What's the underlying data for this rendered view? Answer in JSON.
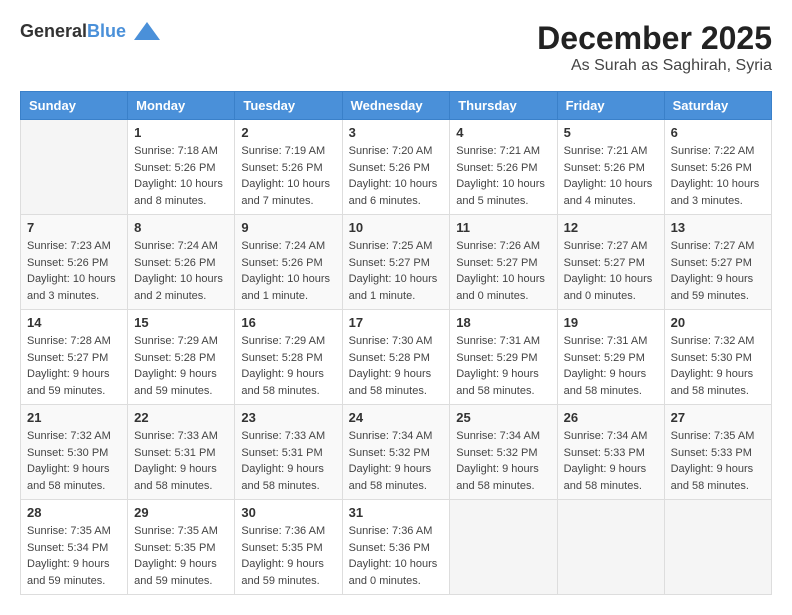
{
  "logo": {
    "general": "General",
    "blue": "Blue"
  },
  "header": {
    "month": "December 2025",
    "location": "As Surah as Saghirah, Syria"
  },
  "weekdays": [
    "Sunday",
    "Monday",
    "Tuesday",
    "Wednesday",
    "Thursday",
    "Friday",
    "Saturday"
  ],
  "weeks": [
    [
      {
        "day": "",
        "info": ""
      },
      {
        "day": "1",
        "info": "Sunrise: 7:18 AM\nSunset: 5:26 PM\nDaylight: 10 hours\nand 8 minutes."
      },
      {
        "day": "2",
        "info": "Sunrise: 7:19 AM\nSunset: 5:26 PM\nDaylight: 10 hours\nand 7 minutes."
      },
      {
        "day": "3",
        "info": "Sunrise: 7:20 AM\nSunset: 5:26 PM\nDaylight: 10 hours\nand 6 minutes."
      },
      {
        "day": "4",
        "info": "Sunrise: 7:21 AM\nSunset: 5:26 PM\nDaylight: 10 hours\nand 5 minutes."
      },
      {
        "day": "5",
        "info": "Sunrise: 7:21 AM\nSunset: 5:26 PM\nDaylight: 10 hours\nand 4 minutes."
      },
      {
        "day": "6",
        "info": "Sunrise: 7:22 AM\nSunset: 5:26 PM\nDaylight: 10 hours\nand 3 minutes."
      }
    ],
    [
      {
        "day": "7",
        "info": "Sunrise: 7:23 AM\nSunset: 5:26 PM\nDaylight: 10 hours\nand 3 minutes."
      },
      {
        "day": "8",
        "info": "Sunrise: 7:24 AM\nSunset: 5:26 PM\nDaylight: 10 hours\nand 2 minutes."
      },
      {
        "day": "9",
        "info": "Sunrise: 7:24 AM\nSunset: 5:26 PM\nDaylight: 10 hours\nand 1 minute."
      },
      {
        "day": "10",
        "info": "Sunrise: 7:25 AM\nSunset: 5:27 PM\nDaylight: 10 hours\nand 1 minute."
      },
      {
        "day": "11",
        "info": "Sunrise: 7:26 AM\nSunset: 5:27 PM\nDaylight: 10 hours\nand 0 minutes."
      },
      {
        "day": "12",
        "info": "Sunrise: 7:27 AM\nSunset: 5:27 PM\nDaylight: 10 hours\nand 0 minutes."
      },
      {
        "day": "13",
        "info": "Sunrise: 7:27 AM\nSunset: 5:27 PM\nDaylight: 9 hours\nand 59 minutes."
      }
    ],
    [
      {
        "day": "14",
        "info": "Sunrise: 7:28 AM\nSunset: 5:27 PM\nDaylight: 9 hours\nand 59 minutes."
      },
      {
        "day": "15",
        "info": "Sunrise: 7:29 AM\nSunset: 5:28 PM\nDaylight: 9 hours\nand 59 minutes."
      },
      {
        "day": "16",
        "info": "Sunrise: 7:29 AM\nSunset: 5:28 PM\nDaylight: 9 hours\nand 58 minutes."
      },
      {
        "day": "17",
        "info": "Sunrise: 7:30 AM\nSunset: 5:28 PM\nDaylight: 9 hours\nand 58 minutes."
      },
      {
        "day": "18",
        "info": "Sunrise: 7:31 AM\nSunset: 5:29 PM\nDaylight: 9 hours\nand 58 minutes."
      },
      {
        "day": "19",
        "info": "Sunrise: 7:31 AM\nSunset: 5:29 PM\nDaylight: 9 hours\nand 58 minutes."
      },
      {
        "day": "20",
        "info": "Sunrise: 7:32 AM\nSunset: 5:30 PM\nDaylight: 9 hours\nand 58 minutes."
      }
    ],
    [
      {
        "day": "21",
        "info": "Sunrise: 7:32 AM\nSunset: 5:30 PM\nDaylight: 9 hours\nand 58 minutes."
      },
      {
        "day": "22",
        "info": "Sunrise: 7:33 AM\nSunset: 5:31 PM\nDaylight: 9 hours\nand 58 minutes."
      },
      {
        "day": "23",
        "info": "Sunrise: 7:33 AM\nSunset: 5:31 PM\nDaylight: 9 hours\nand 58 minutes."
      },
      {
        "day": "24",
        "info": "Sunrise: 7:34 AM\nSunset: 5:32 PM\nDaylight: 9 hours\nand 58 minutes."
      },
      {
        "day": "25",
        "info": "Sunrise: 7:34 AM\nSunset: 5:32 PM\nDaylight: 9 hours\nand 58 minutes."
      },
      {
        "day": "26",
        "info": "Sunrise: 7:34 AM\nSunset: 5:33 PM\nDaylight: 9 hours\nand 58 minutes."
      },
      {
        "day": "27",
        "info": "Sunrise: 7:35 AM\nSunset: 5:33 PM\nDaylight: 9 hours\nand 58 minutes."
      }
    ],
    [
      {
        "day": "28",
        "info": "Sunrise: 7:35 AM\nSunset: 5:34 PM\nDaylight: 9 hours\nand 59 minutes."
      },
      {
        "day": "29",
        "info": "Sunrise: 7:35 AM\nSunset: 5:35 PM\nDaylight: 9 hours\nand 59 minutes."
      },
      {
        "day": "30",
        "info": "Sunrise: 7:36 AM\nSunset: 5:35 PM\nDaylight: 9 hours\nand 59 minutes."
      },
      {
        "day": "31",
        "info": "Sunrise: 7:36 AM\nSunset: 5:36 PM\nDaylight: 10 hours\nand 0 minutes."
      },
      {
        "day": "",
        "info": ""
      },
      {
        "day": "",
        "info": ""
      },
      {
        "day": "",
        "info": ""
      }
    ]
  ]
}
